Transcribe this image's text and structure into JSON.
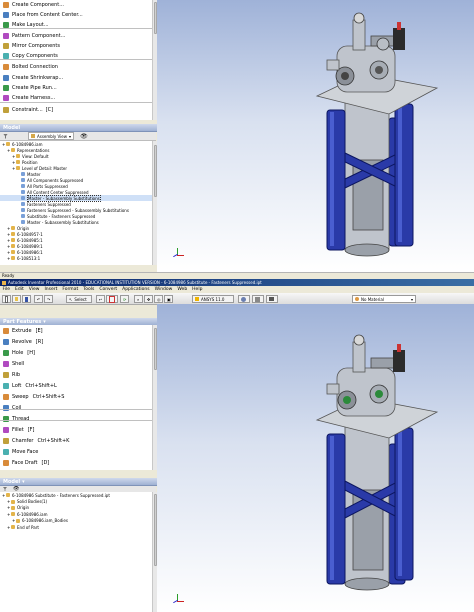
{
  "top": {
    "assembly_panel_items": [
      {
        "label": "Create Component...",
        "icon": "create-component-icon"
      },
      {
        "label": "Place from Content Center...",
        "icon": "content-center-icon"
      },
      {
        "label": "Make Layout...",
        "icon": "layout-icon"
      },
      {
        "label": "Pattern Component...",
        "icon": "pattern-icon"
      },
      {
        "label": "Mirror Components",
        "icon": "mirror-icon"
      },
      {
        "label": "Copy Components",
        "icon": "copy-icon"
      },
      {
        "label": "Bolted Connection",
        "icon": "bolt-icon"
      },
      {
        "label": "Create Shrinkwrap...",
        "icon": "shrinkwrap-icon"
      },
      {
        "label": "Create Pipe Run...",
        "icon": "pipe-icon"
      },
      {
        "label": "Create Harness...",
        "icon": "harness-icon"
      },
      {
        "label": "Constraint...",
        "shortcut": "[C]",
        "icon": "constraint-icon"
      }
    ],
    "model_header": "Model",
    "browser_mode": "Assembly View",
    "tree": [
      {
        "label": "6-1084986.iam",
        "indent": 0
      },
      {
        "label": "Representations",
        "indent": 1
      },
      {
        "label": "View: Default",
        "indent": 2
      },
      {
        "label": "Position",
        "indent": 2
      },
      {
        "label": "Level of Detail: Master",
        "indent": 2
      },
      {
        "label": "Master",
        "indent": 3
      },
      {
        "label": "All Components Suppressed",
        "indent": 3
      },
      {
        "label": "All Parts Suppressed",
        "indent": 3
      },
      {
        "label": "All Content Center Suppressed",
        "indent": 3
      },
      {
        "label": "Master - Subassembly Substitutions",
        "indent": 3,
        "highlight": true
      },
      {
        "label": "Fasteners Suppressed",
        "indent": 3
      },
      {
        "label": "Fasteners Suppressed - Subassembly Substitutions",
        "indent": 3
      },
      {
        "label": "Substitute - Fasteners Suppressed",
        "indent": 3
      },
      {
        "label": "Master - Subassembly Substitutions",
        "indent": 3
      },
      {
        "label": "Origin",
        "indent": 1
      },
      {
        "label": "6-1084957-1",
        "indent": 1
      },
      {
        "label": "6-1084985:1",
        "indent": 1
      },
      {
        "label": "6-1084989:1",
        "indent": 1
      },
      {
        "label": "6-1084986:1",
        "indent": 1
      },
      {
        "label": "6-108513:1",
        "indent": 1
      }
    ]
  },
  "status": "Ready",
  "bottom": {
    "window_title": "Autodesk Inventor Professional 2010 - EDUCATIONAL INSTITUTION VERSION - 6-1084986 Substitute - Fasteners Suppressed.ipt",
    "menu": [
      "File",
      "Edit",
      "View",
      "Insert",
      "Format",
      "Tools",
      "Convert",
      "Applications",
      "Window",
      "Web",
      "Help"
    ],
    "select_label": "Select",
    "ansys_label": "ANSYS 11.0",
    "material": "No Material",
    "part_features_header": "Part Features",
    "features": [
      {
        "label": "Extrude",
        "shortcut": "[E]",
        "icon": "extrude-icon"
      },
      {
        "label": "Revolve",
        "shortcut": "[R]",
        "icon": "revolve-icon"
      },
      {
        "label": "Hole",
        "shortcut": "[H]",
        "icon": "hole-icon"
      },
      {
        "label": "Shell",
        "shortcut": "",
        "icon": "shell-icon"
      },
      {
        "label": "Rib",
        "shortcut": "",
        "icon": "rib-icon"
      },
      {
        "label": "Loft",
        "shortcut": "Ctrl+Shift+L",
        "icon": "loft-icon"
      },
      {
        "label": "Sweep",
        "shortcut": "Ctrl+Shift+S",
        "icon": "sweep-icon"
      },
      {
        "label": "Coil",
        "shortcut": "",
        "icon": "coil-icon"
      },
      {
        "label": "Thread",
        "shortcut": "",
        "icon": "thread-icon"
      },
      {
        "label": "Fillet",
        "shortcut": "[F]",
        "icon": "fillet-icon"
      },
      {
        "label": "Chamfer",
        "shortcut": "Ctrl+Shift+K",
        "icon": "chamfer-icon"
      },
      {
        "label": "Move Face",
        "shortcut": "",
        "icon": "move-face-icon"
      },
      {
        "label": "Face Draft",
        "shortcut": "[D]",
        "icon": "face-draft-icon"
      }
    ],
    "model_header": "Model",
    "tree": [
      {
        "label": "6-1084986 Substitute - Fasteners Suppressed.ipt",
        "indent": 0
      },
      {
        "label": "Solid Bodies(1)",
        "indent": 1
      },
      {
        "label": "Origin",
        "indent": 1
      },
      {
        "label": "6-1084986.iam",
        "indent": 1
      },
      {
        "label": "6-1084986.iam_Bodies",
        "indent": 2
      },
      {
        "label": "End of Part",
        "indent": 1
      }
    ]
  }
}
